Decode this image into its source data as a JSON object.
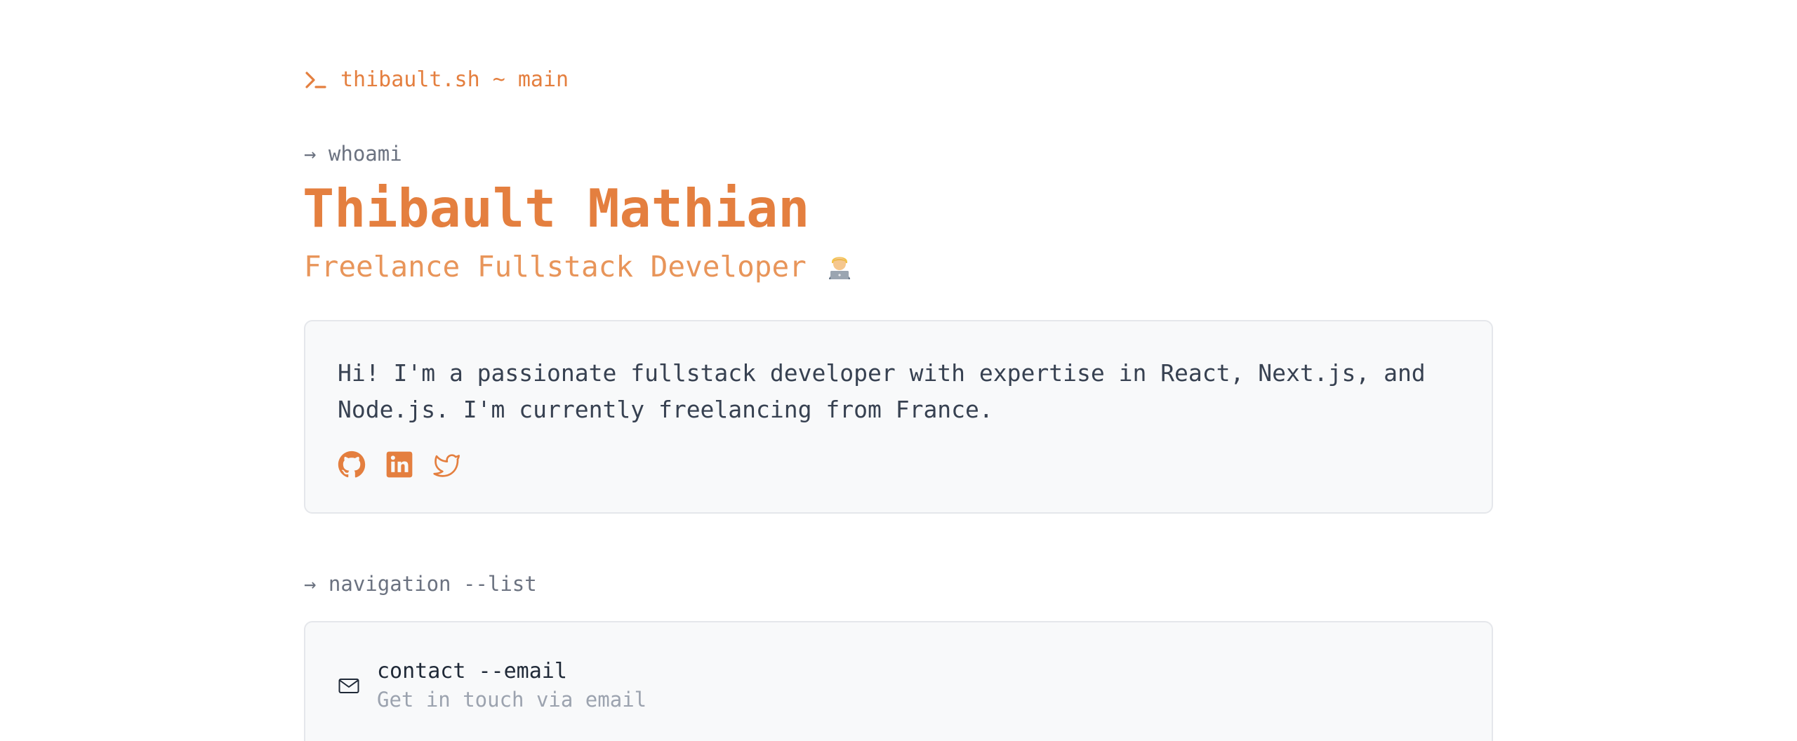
{
  "header": {
    "brand_label": "thibault.sh ~ main",
    "accent_color": "#e47f3f"
  },
  "hero": {
    "command": "→ whoami",
    "name": "Thibault Mathian",
    "subtitle": "Freelance Fullstack Developer",
    "subtitle_emoji": "technologist"
  },
  "about": {
    "text": "Hi! I'm a passionate fullstack developer with expertise in React, Next.js, and Node.js. I'm currently freelancing from France.",
    "socials": [
      {
        "icon": "github-icon"
      },
      {
        "icon": "linkedin-icon"
      },
      {
        "icon": "twitter-icon"
      }
    ]
  },
  "navigation": {
    "command": "→ navigation --list",
    "items": [
      {
        "title": "contact --email",
        "description": "Get in touch via email",
        "icon": "mail-icon"
      },
      {
        "title": "",
        "description": ""
      }
    ]
  }
}
